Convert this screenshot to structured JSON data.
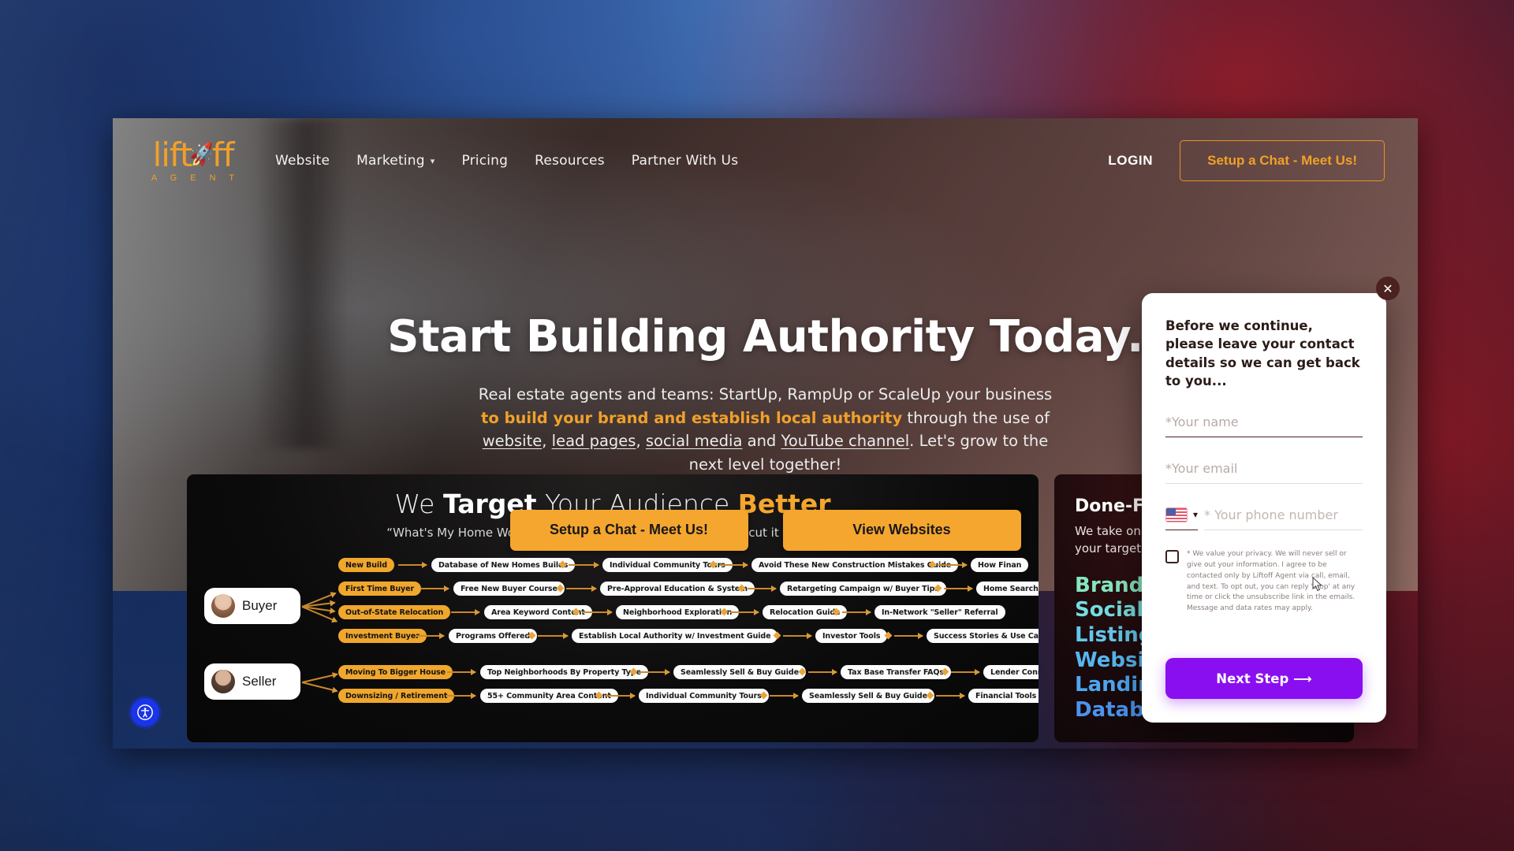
{
  "brand": {
    "logo_text": "liftoff",
    "logo_subtext": "A G E N T",
    "rocket_icon": "rocket-icon"
  },
  "nav": {
    "links": [
      {
        "label": "Website",
        "has_caret": false
      },
      {
        "label": "Marketing",
        "has_caret": true
      },
      {
        "label": "Pricing",
        "has_caret": false
      },
      {
        "label": "Resources",
        "has_caret": false
      },
      {
        "label": "Partner With Us",
        "has_caret": false
      }
    ],
    "login_label": "LOGIN",
    "cta_label": "Setup a Chat - Meet Us!",
    "cta_color": "#f0a02a"
  },
  "hero": {
    "title": "Start Building Authority Today.",
    "sub_1": "Real estate agents and teams: StartUp, RampUp or ScaleUp your business ",
    "sub_highlight": "to build your brand and establish local authority",
    "sub_2": " through the use of ",
    "link_website": "website",
    "link_lead_pages": "lead pages",
    "link_social_media": "social media",
    "link_youtube": "YouTube channel",
    "sub_and": " and ",
    "sub_3": ". Let's grow to the next level together!",
    "sub_comma": ", ",
    "btn_primary": "Setup a Chat - Meet Us!",
    "btn_secondary": "View Websites"
  },
  "target_card": {
    "title_pre": "We ",
    "title_bold": "Target",
    "title_mid": " Your Audience ",
    "title_highlight": "Better",
    "subtitle": "“What's My Home Worth” and “Search for Homes” just don't cut it anymore.",
    "personas": [
      {
        "name": "Buyer",
        "avatar": "buyer-avatar"
      },
      {
        "name": "Seller",
        "avatar": "seller-avatar"
      }
    ],
    "buyer_rows": [
      [
        "New Build",
        "Database of New Homes Builds",
        "Individual Community Tours",
        "Avoid These New Construction Mistakes Guide",
        "How Finan"
      ],
      [
        "First Time Buyer",
        "Free New Buyer Course",
        "Pre-Approval Education & System",
        "Retargeting Campaign w/ Buyer Tips",
        "Home Search S"
      ],
      [
        "Out-of-State Relocation",
        "Area Keyword Content",
        "Neighborhood Exploration",
        "Relocation Guide",
        "In-Network \"Seller\" Referral"
      ],
      [
        "Investment Buyer",
        "Programs Offered",
        "Establish Local Authority w/ Investment Guide",
        "Investor Tools",
        "Success Stories & Use Cases"
      ]
    ],
    "seller_rows": [
      [
        "Moving To Bigger House",
        "Top Neighborhoods By Property  Type",
        "Seamlessly Sell & Buy Guide",
        "Tax Base Transfer FAQs",
        "Lender Connec"
      ],
      [
        "Downsizing / Retirement",
        "55+ Community Area Content",
        "Individual Community Tours",
        "Seamlessly Sell & Buy Guide",
        "Financial Tools & Ca"
      ]
    ]
  },
  "done_card": {
    "title": "Done-Fo",
    "subtitle_line1": "We take on",
    "subtitle_line2": "your target",
    "items": [
      {
        "label": "Branding",
        "color": "#86e6c0"
      },
      {
        "label": "Social",
        "color": "#74dde0"
      },
      {
        "label": "Listings",
        "color": "#63c7ec"
      },
      {
        "label": "Website",
        "color": "#56b6ef"
      },
      {
        "label": "Landing",
        "color": "#4ea6f0"
      },
      {
        "label": "Database Systems",
        "color": "#4a94ee"
      }
    ]
  },
  "popup": {
    "close_icon": "close-icon",
    "intro": "Before we continue, please leave your contact details so we can get back to you...",
    "name_placeholder": "*Your name",
    "name_value": "",
    "email_placeholder": "*Your email",
    "email_value": "",
    "country_flag": "us-flag-icon",
    "country_caret": "chevron-down-icon",
    "phone_placeholder": "* Your phone number",
    "phone_value": "",
    "consent_text": "* We value your privacy. We will never sell or give out your information. I agree to be contacted only by Liftoff Agent via call, email, and text. To opt out, you can reply 'stop' at any time or click the unsubscribe link in the emails. Message and data rates may apply.",
    "next_label": "Next Step ⟶",
    "next_color": "#8a0ff0"
  },
  "accessibility": {
    "icon": "accessibility-icon",
    "color": "#1a34e8"
  }
}
